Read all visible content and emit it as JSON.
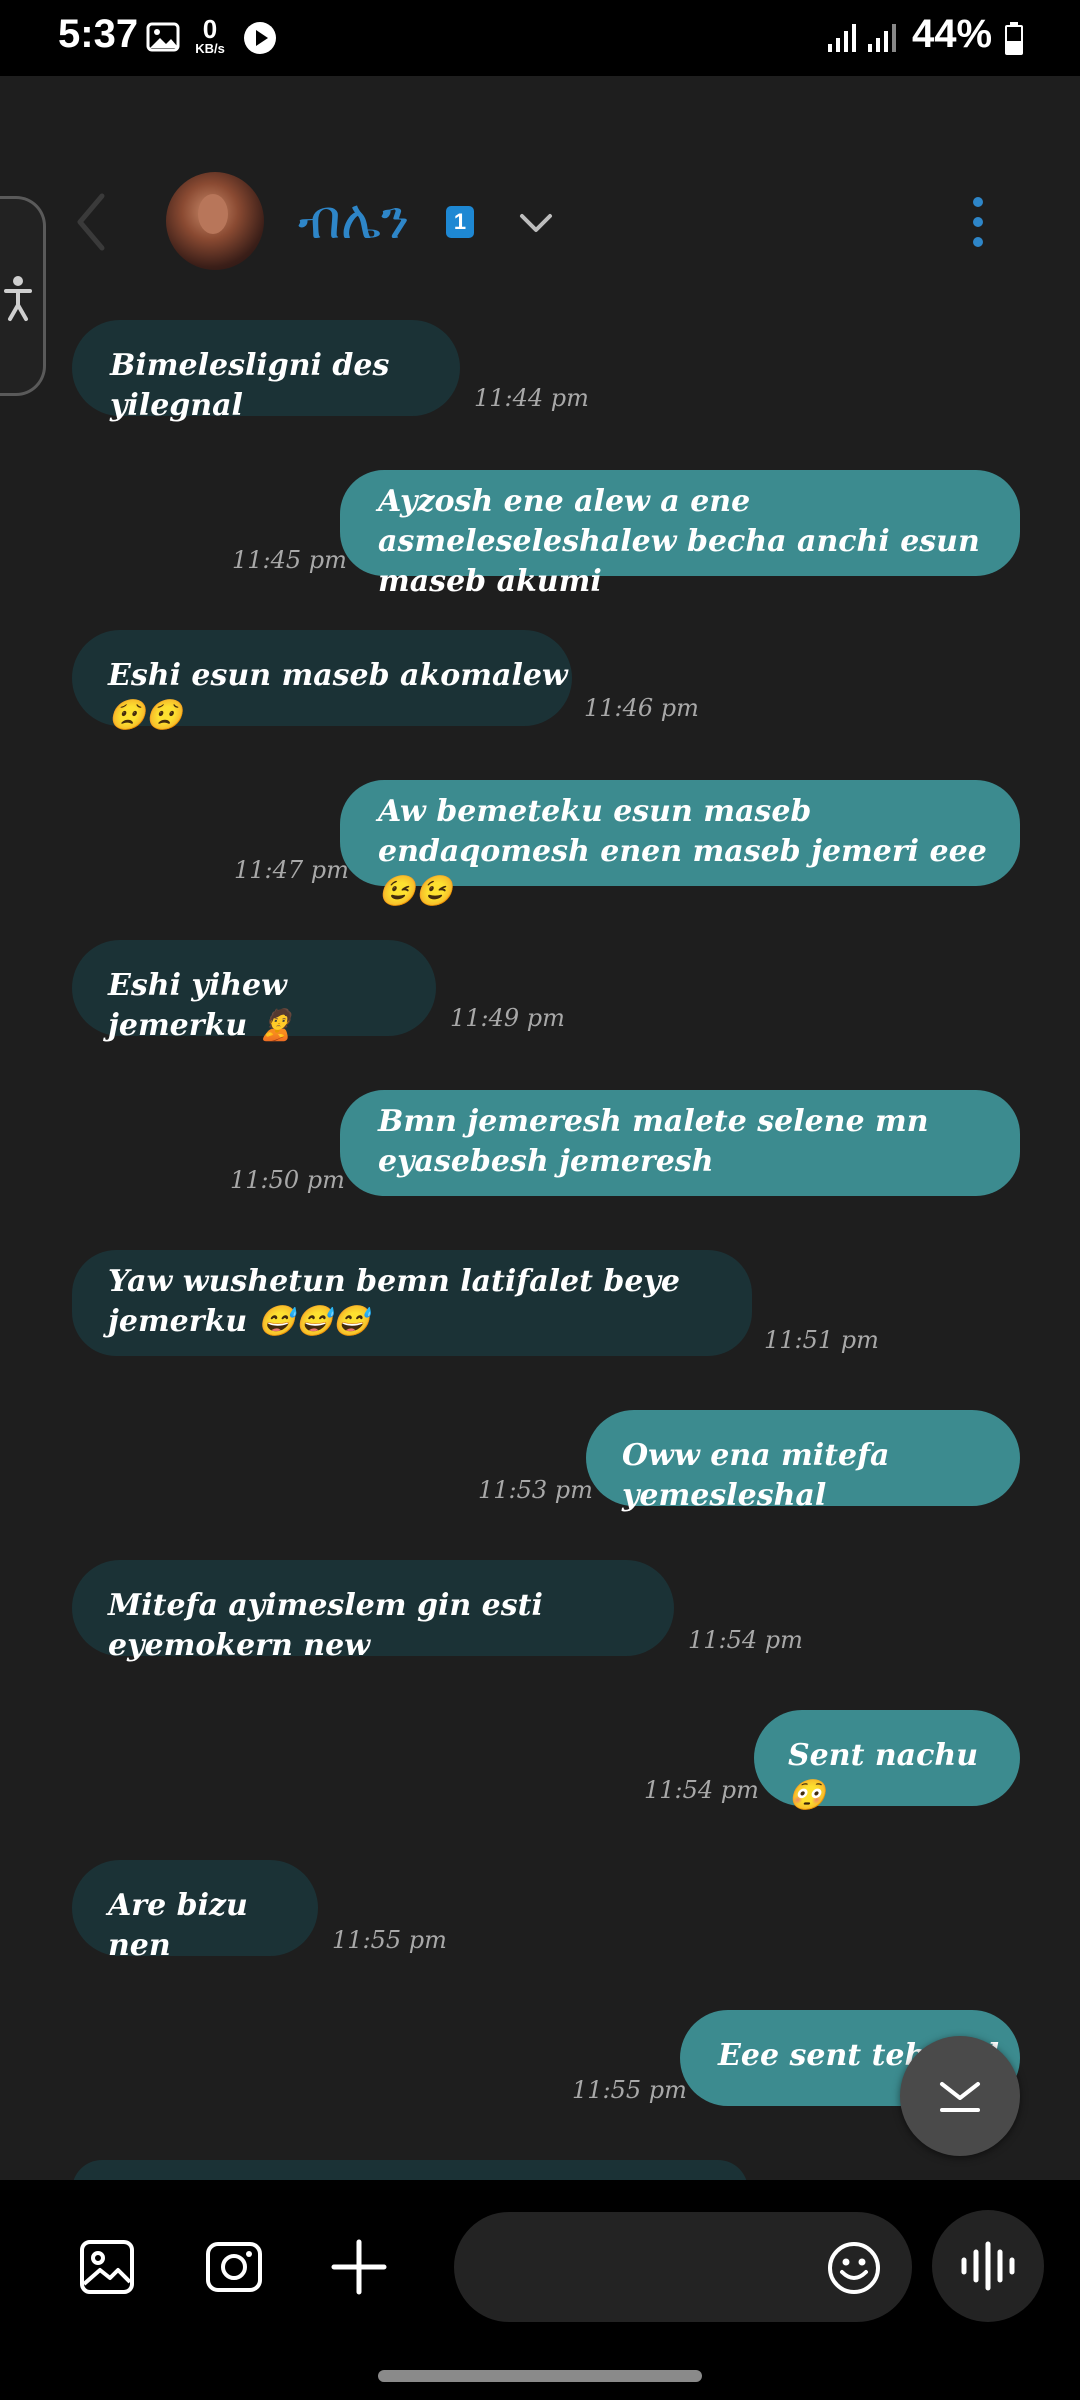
{
  "status_bar": {
    "time": "5:37",
    "net_speed_value": "0",
    "net_speed_unit": "KB/s",
    "battery_percent": "44%"
  },
  "header": {
    "contact_name": "ብሌን",
    "unread_count": "1"
  },
  "messages": [
    {
      "direction": "received",
      "text": "Bimelesligni des yilegnal",
      "time": "11:44 pm"
    },
    {
      "direction": "sent",
      "text": "Ayzosh ene alew a ene asmeleseleshalew becha anchi esun maseb akumi",
      "time": "11:45 pm"
    },
    {
      "direction": "received",
      "text": "Eshi esun maseb akomalew 😟😟",
      "time": "11:46 pm"
    },
    {
      "direction": "sent",
      "text": "Aw bemeteku esun maseb endaqomesh enen maseb jemeri eee😉😉",
      "time": "11:47 pm"
    },
    {
      "direction": "received",
      "text": "Eshi yihew jemerku 🙎",
      "time": "11:49 pm"
    },
    {
      "direction": "sent",
      "text": "Bmn jemeresh malete selene mn eyasebesh jemeresh",
      "time": "11:50 pm"
    },
    {
      "direction": "received",
      "text": "Yaw wushetun bemn latifalet beye jemerku 😅😅😅",
      "time": "11:51 pm"
    },
    {
      "direction": "sent",
      "text": "Oww ena mitefa yemesleshal",
      "time": "11:53 pm"
    },
    {
      "direction": "received",
      "text": "Mitefa ayimeslem gin esti eyemokern new",
      "time": "11:54 pm"
    },
    {
      "direction": "sent",
      "text": "Sent nachu 😳",
      "time": "11:54 pm"
    },
    {
      "direction": "received",
      "text": "Are bizu nen",
      "time": "11:55 pm"
    },
    {
      "direction": "sent",
      "text": "Eee sent tehonal",
      "time": "11:55 pm"
    }
  ],
  "icons": {
    "back": "back-arrow-icon",
    "dropdown": "chevron-down-icon",
    "more": "more-vertical-icon",
    "accessibility": "accessibility-icon",
    "scroll_down": "scroll-down-icon",
    "gallery": "gallery-icon",
    "camera": "camera-icon",
    "add": "plus-icon",
    "emoji": "emoji-icon",
    "voice": "voice-wave-icon"
  },
  "colors": {
    "received_bubble": "#1b3236",
    "sent_bubble": "#3c8b8f",
    "name_accent": "#2e86c8",
    "badge": "#1e88d3"
  }
}
